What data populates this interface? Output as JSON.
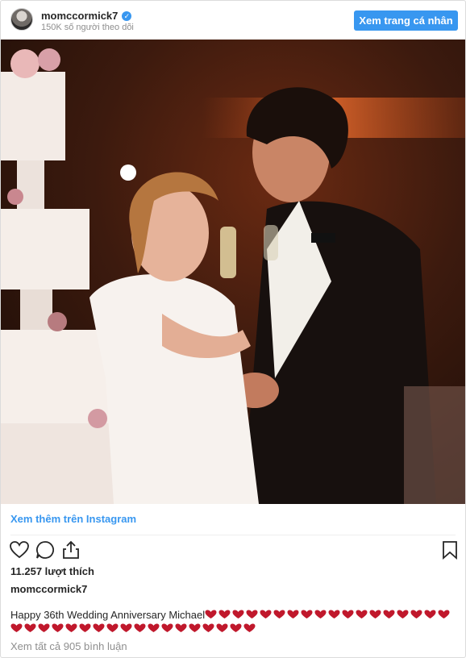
{
  "header": {
    "username": "momccormick7",
    "followers": "150K số người theo dõi",
    "profile_button": "Xem trang cá nhân"
  },
  "photo": {
    "description_icon": "wedding-photo"
  },
  "view_more": "Xem thêm trên Instagram",
  "actions": {
    "like_icon": "heart-outline-icon",
    "comment_icon": "comment-icon",
    "share_icon": "share-icon",
    "save_icon": "bookmark-icon"
  },
  "likes": "11.257 lượt thích",
  "author": "momccormick7",
  "caption": {
    "text": "Happy 36th Wedding Anniversary Michael",
    "heart_emoji_count": 36,
    "heart_color": "#c0182c"
  },
  "comments_link": "Xem tất cả 905 bình luận",
  "colors": {
    "accent": "#3897f0",
    "muted": "#8e8e8e",
    "text": "#262626"
  }
}
